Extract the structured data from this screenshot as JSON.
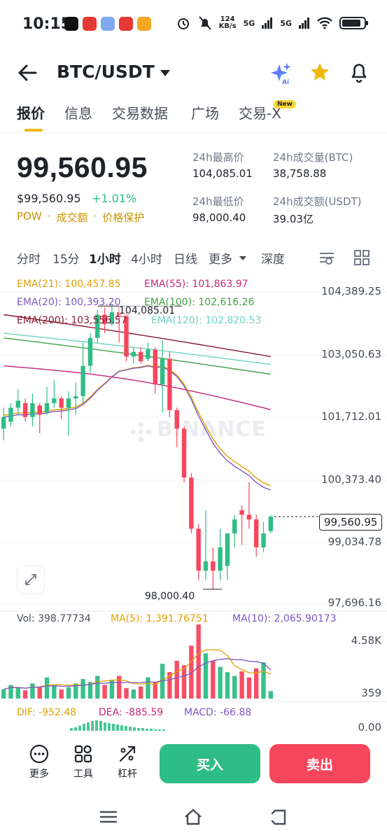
{
  "status_bar": {
    "time": "10:15",
    "net_speed_value": "124",
    "net_speed_unit": "KB/s",
    "sig1": "5G",
    "sig2": "5G"
  },
  "header": {
    "pair": "BTC/USDT"
  },
  "tabs": [
    {
      "label": "报价"
    },
    {
      "label": "信息"
    },
    {
      "label": "交易数据"
    },
    {
      "label": "广场"
    },
    {
      "label": "交易-X"
    }
  ],
  "new_badge": "New",
  "price": {
    "last": "99,560.95",
    "usd": "$99,560.95",
    "change": "+1.01%",
    "tags": [
      "POW",
      "成交额",
      "价格保护"
    ]
  },
  "stats": {
    "high_label": "24h最高价",
    "high_value": "104,085.01",
    "low_label": "24h最低价",
    "low_value": "98,000.40",
    "vol_btc_label": "24h成交量(BTC)",
    "vol_btc_value": "38,758.88",
    "vol_usdt_label": "24h成交额(USDT)",
    "vol_usdt_value": "39.03亿"
  },
  "timeframes": {
    "items": [
      "分时",
      "15分",
      "1小时",
      "4小时",
      "日线",
      "更多",
      "深度"
    ],
    "active": "1小时"
  },
  "ema_legend": {
    "ema21": "EMA(21): 100,457.85",
    "ema55": "EMA(55): 101,863.97",
    "ema20": "EMA(20): 100,393.20",
    "ema100": "EMA(100): 102,616.26",
    "ema200": "EMA(200): 103,556.57",
    "ema120": "EMA(120): 102,820.53"
  },
  "colors": {
    "up": "#2ebd85",
    "down": "#f6465d",
    "brand": "#f0b90b",
    "ema21": "#e0a100",
    "ema55": "#c4287a",
    "ema20": "#7e57c2",
    "ema100": "#43a047",
    "ema200": "#8b1a36",
    "ema120": "#6fd3c0"
  },
  "watermark": "BINANCE",
  "chart_data": {
    "type": "candlestick",
    "y_axis_ticks": [
      "104,389.25",
      "103,050.63",
      "101,712.01",
      "100,373.40",
      "99,034.78",
      "97,696.16"
    ],
    "current_price_tag": "99,560.95",
    "high_annotation": "104,085.01",
    "low_annotation": "98,000.40",
    "candles": [
      {
        "o": 101450,
        "c": 101700,
        "h": 101900,
        "l": 101200
      },
      {
        "o": 101600,
        "c": 101900,
        "h": 102000,
        "l": 101500
      },
      {
        "o": 101900,
        "c": 102050,
        "h": 102300,
        "l": 101750
      },
      {
        "o": 102000,
        "c": 101700,
        "h": 102100,
        "l": 101600
      },
      {
        "o": 101700,
        "c": 102000,
        "h": 102200,
        "l": 101500
      },
      {
        "o": 101950,
        "c": 101750,
        "h": 102000,
        "l": 101350
      },
      {
        "o": 101800,
        "c": 102000,
        "h": 102350,
        "l": 101750
      },
      {
        "o": 102000,
        "c": 102100,
        "h": 102500,
        "l": 101900
      },
      {
        "o": 102100,
        "c": 101900,
        "h": 102150,
        "l": 101650
      },
      {
        "o": 101900,
        "c": 102100,
        "h": 102250,
        "l": 101300
      },
      {
        "o": 102100,
        "c": 102150,
        "h": 102450,
        "l": 101750
      },
      {
        "o": 102150,
        "c": 102800,
        "h": 103300,
        "l": 102000
      },
      {
        "o": 102800,
        "c": 103400,
        "h": 103500,
        "l": 102650
      },
      {
        "o": 103400,
        "c": 103900,
        "h": 104000,
        "l": 103300
      },
      {
        "o": 103900,
        "c": 103700,
        "h": 104050,
        "l": 103500
      },
      {
        "o": 103700,
        "c": 103950,
        "h": 104085,
        "l": 103650
      },
      {
        "o": 103950,
        "c": 103850,
        "h": 104085,
        "l": 103300
      },
      {
        "o": 103900,
        "c": 103000,
        "h": 104000,
        "l": 102900
      },
      {
        "o": 103000,
        "c": 103100,
        "h": 103200,
        "l": 102850
      },
      {
        "o": 103100,
        "c": 102900,
        "h": 103200,
        "l": 102850
      },
      {
        "o": 102950,
        "c": 103150,
        "h": 103300,
        "l": 102900
      },
      {
        "o": 103150,
        "c": 102400,
        "h": 103200,
        "l": 102200
      },
      {
        "o": 102400,
        "c": 102950,
        "h": 103350,
        "l": 101800
      },
      {
        "o": 102950,
        "c": 101850,
        "h": 103100,
        "l": 101700
      },
      {
        "o": 101850,
        "c": 101450,
        "h": 101900,
        "l": 101050
      },
      {
        "o": 101450,
        "c": 100400,
        "h": 101500,
        "l": 100300
      },
      {
        "o": 100400,
        "c": 99300,
        "h": 100500,
        "l": 99200
      },
      {
        "o": 99300,
        "c": 98400,
        "h": 99400,
        "l": 98200
      },
      {
        "o": 98400,
        "c": 98600,
        "h": 99700,
        "l": 98200
      },
      {
        "o": 98600,
        "c": 98400,
        "h": 98900,
        "l": 98000
      },
      {
        "o": 98400,
        "c": 98900,
        "h": 99300,
        "l": 98200
      },
      {
        "o": 98500,
        "c": 99200,
        "h": 99200,
        "l": 98200
      },
      {
        "o": 99200,
        "c": 99500,
        "h": 99600,
        "l": 98900
      },
      {
        "o": 99700,
        "c": 99600,
        "h": 99800,
        "l": 98950
      },
      {
        "o": 99600,
        "c": 99500,
        "h": 100300,
        "l": 99300
      },
      {
        "o": 99500,
        "c": 98900,
        "h": 99600,
        "l": 98700
      },
      {
        "o": 98900,
        "c": 99200,
        "h": 99450,
        "l": 98800
      },
      {
        "o": 99250,
        "c": 99561,
        "h": 99600,
        "l": 99200
      }
    ]
  },
  "volume": {
    "vol": "Vol: 398.77734",
    "ma5": "MA(5): 1,391.76751",
    "ma10": "MA(10): 2,065.90173",
    "axis_top": "4.58K",
    "axis_bottom": "359",
    "bars": [
      0.12,
      0.18,
      0.14,
      0.11,
      0.2,
      0.15,
      0.28,
      0.17,
      0.12,
      0.15,
      0.2,
      0.26,
      0.22,
      0.3,
      0.18,
      0.25,
      0.3,
      0.14,
      0.12,
      0.16,
      0.28,
      0.22,
      0.46,
      0.35,
      0.5,
      0.44,
      0.7,
      0.98,
      0.6,
      0.5,
      0.42,
      0.35,
      0.3,
      0.36,
      0.28,
      0.4,
      0.48,
      0.1
    ]
  },
  "macd": {
    "dif": "DIF: -952.48",
    "dea": "DEA: -885.59",
    "macd": "MACD: -66.88",
    "axis": "0.00"
  },
  "actions": {
    "more": "更多",
    "tools": "工具",
    "leverage": "杠杆",
    "buy": "买入",
    "sell": "卖出"
  }
}
